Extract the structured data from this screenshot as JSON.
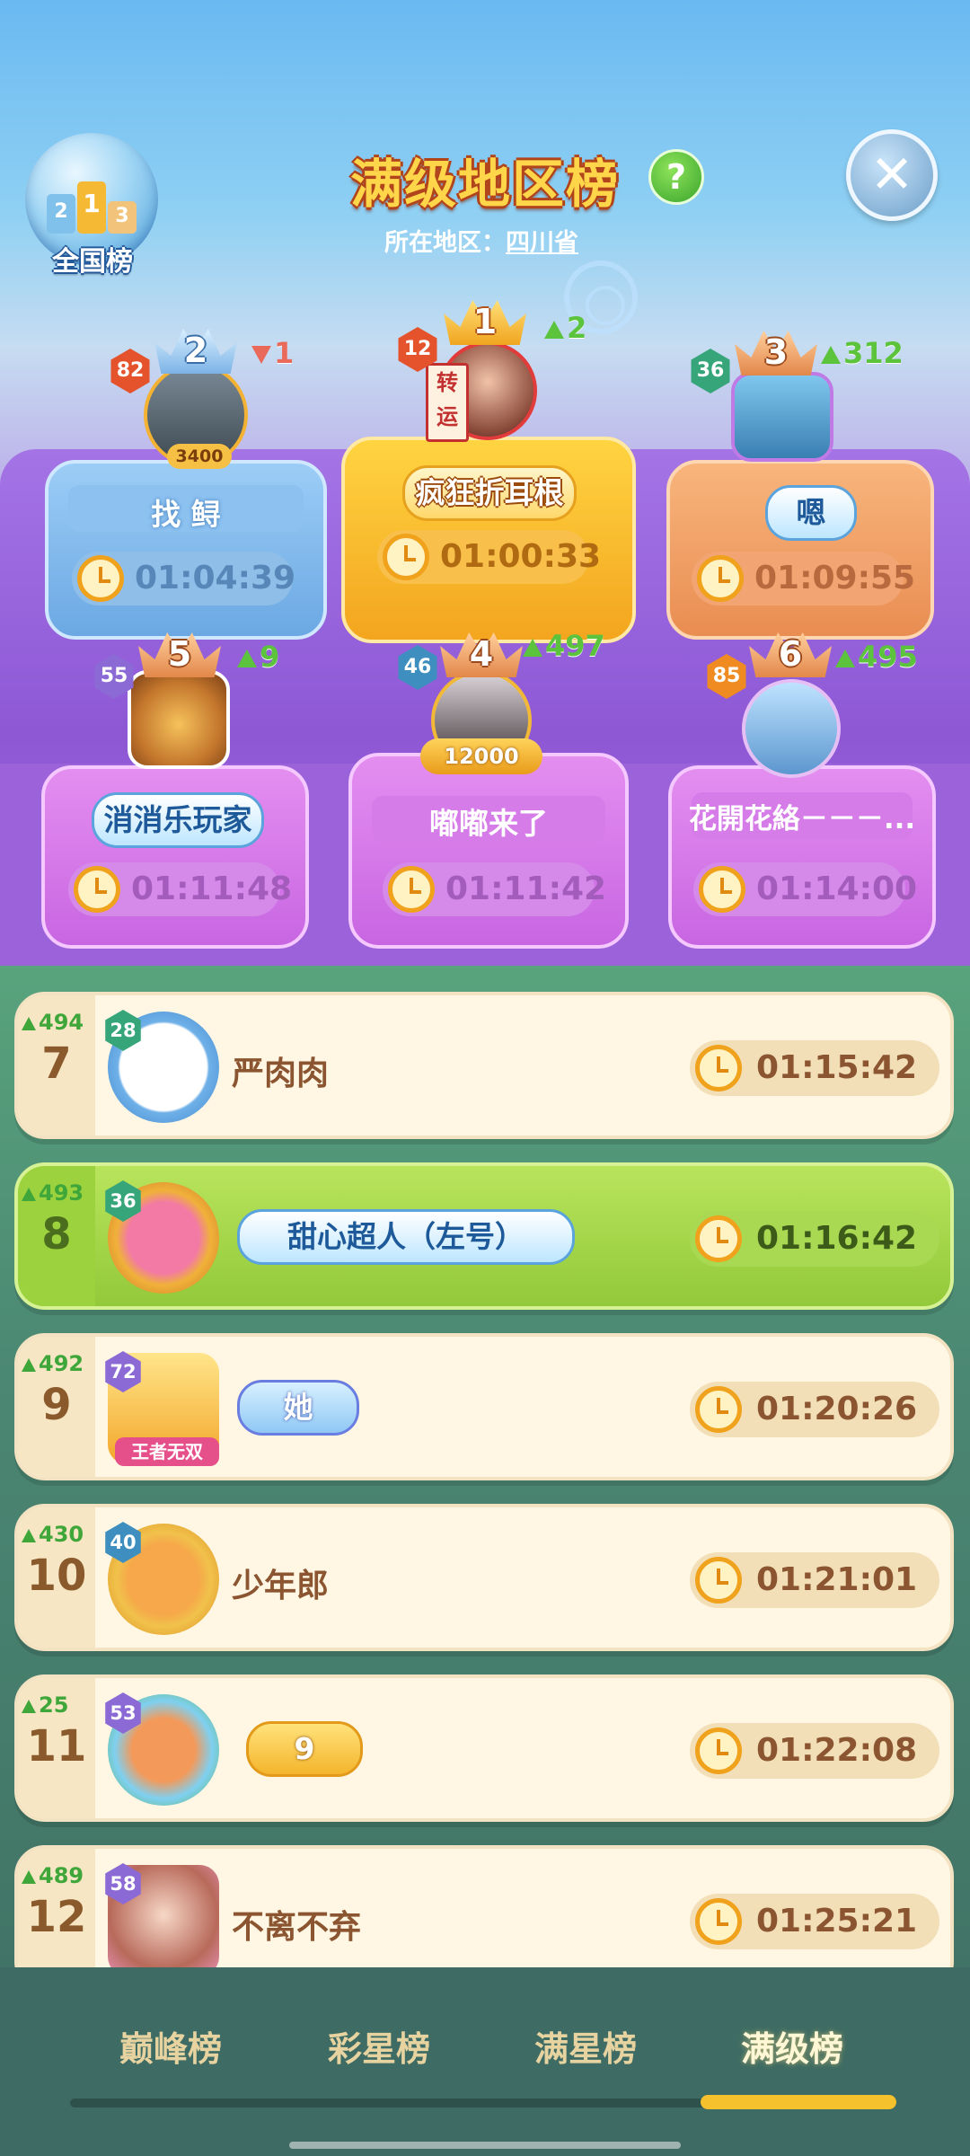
{
  "header": {
    "title": "满级地区榜",
    "help_icon": "question-mark",
    "close_icon": "x",
    "region_label": "所在地区：",
    "region_value": "四川省",
    "national_label": "全国榜",
    "national_podium": [
      "2",
      "1",
      "3"
    ]
  },
  "podium": [
    {
      "rank": "1",
      "level": "12",
      "trend": "2",
      "trend_dir": "up",
      "nickname": "疯狂折耳根",
      "time": "01:00:33"
    },
    {
      "rank": "2",
      "level": "82",
      "trend": "1",
      "trend_dir": "down",
      "nickname": "找 鲟",
      "time": "01:04:39",
      "frame_badge": "3400"
    },
    {
      "rank": "3",
      "level": "36",
      "trend": "312",
      "trend_dir": "up",
      "nickname": "嗯",
      "time": "01:09:55"
    },
    {
      "rank": "4",
      "level": "46",
      "trend": "497",
      "trend_dir": "up",
      "nickname": "嘟嘟来了",
      "time": "01:11:42",
      "frame_badge": "12000"
    },
    {
      "rank": "5",
      "level": "55",
      "trend": "9",
      "trend_dir": "up",
      "nickname": "消消乐玩家",
      "time": "01:11:48"
    },
    {
      "rank": "6",
      "level": "85",
      "trend": "495",
      "trend_dir": "up",
      "nickname": "花開花絡－－－...",
      "time": "01:14:00"
    }
  ],
  "avatar_tag": "转运",
  "list": [
    {
      "rank": "7",
      "trend": "494",
      "level": "28",
      "nickname": "严肉肉",
      "time": "01:15:42"
    },
    {
      "rank": "8",
      "trend": "493",
      "level": "36",
      "nickname": "甜心超人（左号）",
      "time": "01:16:42",
      "highlight": true
    },
    {
      "rank": "9",
      "trend": "492",
      "level": "72",
      "nickname": "她",
      "time": "01:20:26",
      "frame_text": "王者无双"
    },
    {
      "rank": "10",
      "trend": "430",
      "level": "40",
      "nickname": "少年郎",
      "time": "01:21:01"
    },
    {
      "rank": "11",
      "trend": "25",
      "level": "53",
      "nickname": "9",
      "time": "01:22:08"
    },
    {
      "rank": "12",
      "trend": "489",
      "level": "58",
      "nickname": "不离不弃",
      "time": "01:25:21"
    }
  ],
  "tabs": [
    {
      "label": "巅峰榜",
      "active": false
    },
    {
      "label": "彩星榜",
      "active": false
    },
    {
      "label": "满星榜",
      "active": false
    },
    {
      "label": "满级榜",
      "active": true
    }
  ],
  "colors": {
    "accent_gold": "#ffd64a",
    "trend_up": "#5cc33c",
    "trend_down": "#e96a5a",
    "tab_indicator": "#f5c12c"
  }
}
